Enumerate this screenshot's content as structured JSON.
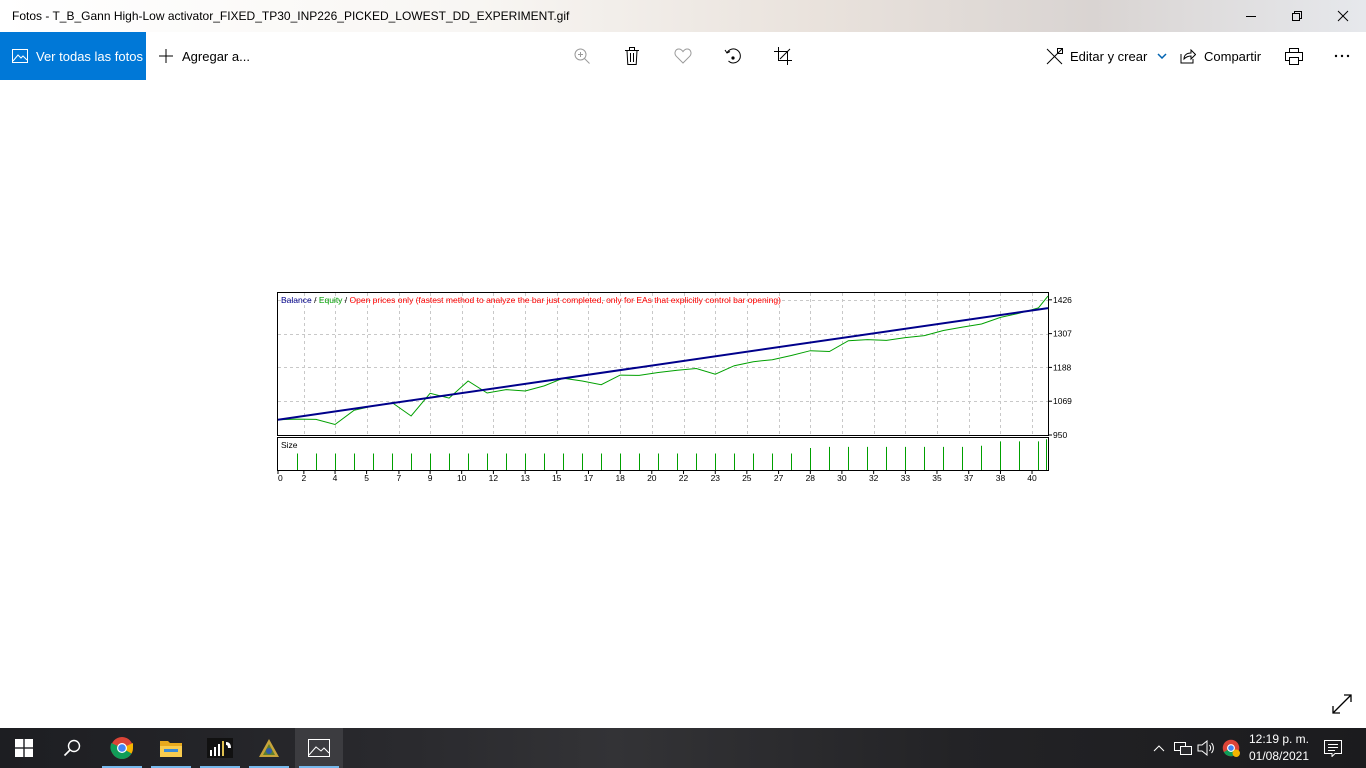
{
  "window": {
    "title": "Fotos - T_B_Gann High-Low activator_FIXED_TP30_INP226_PICKED_LOWEST_DD_EXPERIMENT.gif"
  },
  "toolbar": {
    "view_all_label": "Ver todas las fotos",
    "add_to_label": "Agregar a...",
    "edit_create_label": "Editar y crear",
    "share_label": "Compartir"
  },
  "chart_data": {
    "type": "line",
    "legend": {
      "balance_label": "Balance",
      "equity_label": "Equity",
      "description": "Open prices only (fastest method to analyze the bar just completed, only for EAs that explicitly control bar opening)",
      "sep": " / "
    },
    "colors": {
      "balance": "#00008b",
      "equity": "#00a000",
      "description": "#ff0000",
      "size": "#00a000"
    },
    "ylim": [
      950,
      1450
    ],
    "y_ticks": [
      "1426",
      "1307",
      "1188",
      "1069",
      "950"
    ],
    "y_tick_values": [
      1426,
      1307,
      1188,
      1069,
      950
    ],
    "x_max": 40.5,
    "x_ticks": [
      "0",
      "2",
      "4",
      "5",
      "7",
      "9",
      "10",
      "12",
      "13",
      "15",
      "17",
      "18",
      "20",
      "22",
      "23",
      "25",
      "27",
      "28",
      "30",
      "32",
      "33",
      "35",
      "37",
      "38",
      "40"
    ],
    "x_tick_values": [
      0,
      1.36,
      3,
      4.66,
      6.36,
      8,
      9.66,
      11.33,
      13,
      14.66,
      16.33,
      18,
      19.66,
      21.33,
      23,
      24.66,
      26.33,
      28,
      29.66,
      31.33,
      33,
      34.66,
      36.33,
      38,
      39.66
    ],
    "balance": {
      "x": [
        0,
        40.5
      ],
      "y": [
        1004,
        1397
      ]
    },
    "equity": {
      "x": [
        0,
        1,
        2,
        3,
        4,
        5,
        6,
        7,
        8,
        9,
        10,
        11,
        12,
        13,
        14,
        15,
        16,
        17,
        18,
        19,
        20,
        21,
        22,
        23,
        24,
        25,
        26,
        27,
        28,
        29,
        30,
        31,
        32,
        33,
        34,
        35,
        36,
        37,
        38,
        39,
        40,
        40.5
      ],
      "y": [
        1004,
        1006,
        1005,
        987,
        1037,
        1052,
        1064,
        1017,
        1097,
        1080,
        1140,
        1098,
        1110,
        1105,
        1123,
        1150,
        1140,
        1127,
        1161,
        1160,
        1170,
        1178,
        1184,
        1164,
        1194,
        1208,
        1215,
        1230,
        1247,
        1244,
        1282,
        1286,
        1283,
        1293,
        1300,
        1318,
        1330,
        1341,
        1364,
        1379,
        1398,
        1439
      ]
    },
    "size_label": "Size",
    "size": {
      "x": [
        1,
        2,
        3,
        4,
        5,
        6,
        7,
        8,
        9,
        10,
        11,
        12,
        13,
        14,
        15,
        16,
        17,
        18,
        19,
        20,
        21,
        22,
        23,
        24,
        25,
        26,
        27,
        28,
        29,
        30,
        31,
        32,
        33,
        34,
        35,
        36,
        37,
        38,
        39,
        40,
        40.4
      ],
      "values": [
        15,
        15,
        15,
        15,
        15,
        15,
        15,
        15,
        15,
        15,
        15,
        15,
        15,
        15,
        15,
        15,
        15,
        15,
        15,
        15,
        15,
        15,
        15,
        15,
        15,
        15,
        15,
        20,
        21,
        21,
        21,
        21,
        21,
        21,
        21,
        21,
        22,
        26,
        26,
        26,
        28
      ]
    }
  },
  "taskbar": {
    "apps": [
      "start-icon",
      "search-icon",
      "chrome-icon",
      "file-explorer-icon",
      "metatrader-icon",
      "app-icon",
      "photos-icon"
    ]
  },
  "tray": {
    "time": "12:19 p. m.",
    "date": "01/08/2021"
  }
}
